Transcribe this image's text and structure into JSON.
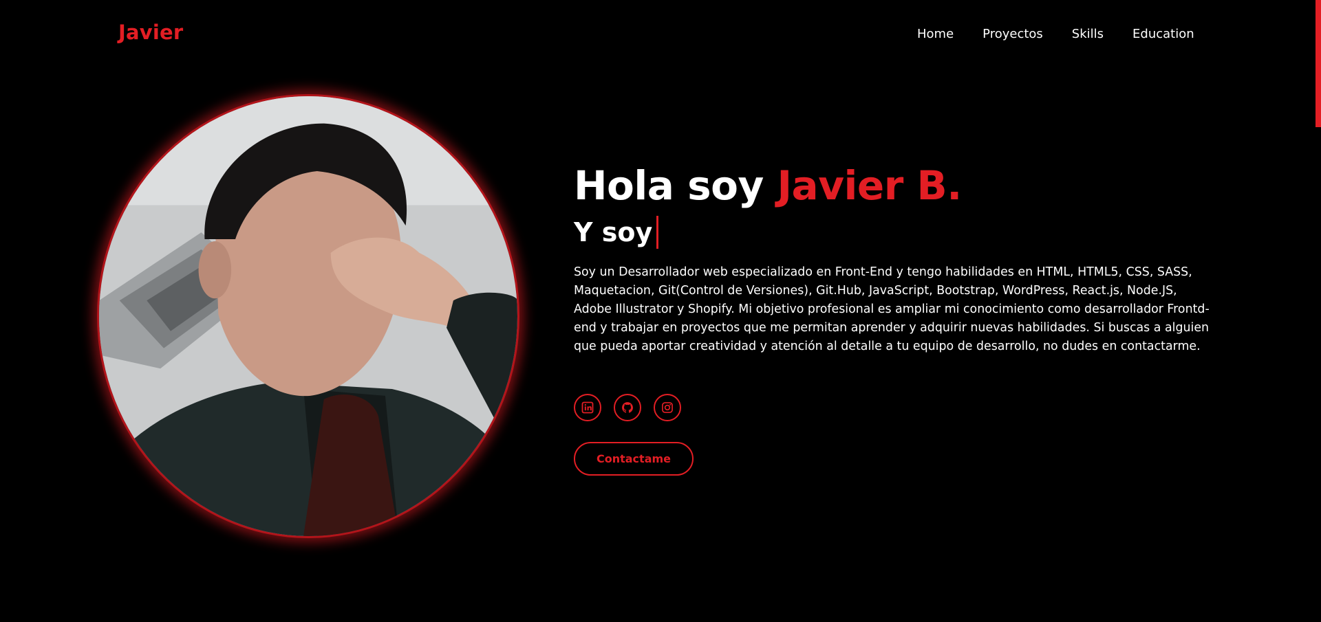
{
  "header": {
    "logo": "Javier",
    "nav": [
      {
        "label": "Home"
      },
      {
        "label": "Proyectos"
      },
      {
        "label": "Skills"
      },
      {
        "label": "Education"
      }
    ]
  },
  "hero": {
    "greeting_prefix": "Hola soy ",
    "greeting_name": "Javier B.",
    "role_prefix": "Y soy",
    "bio": "Soy un Desarrollador web especializado en Front-End y tengo habilidades en HTML, HTML5, CSS, SASS, Maquetacion, Git(Control de Versiones), Git.Hub, JavaScript, Bootstrap, WordPress, React.js, Node.JS, Adobe Illustrator y Shopify. Mi objetivo profesional es ampliar mi conocimiento como desarrollador Frontd-end y trabajar en proyectos que me permitan aprender y adquirir nuevas habilidades. Si buscas a alguien que pueda aportar creatividad y atención al detalle a tu equipo de desarrollo, no dudes en contactarme.",
    "socials": [
      {
        "icon": "linkedin-icon"
      },
      {
        "icon": "github-icon"
      },
      {
        "icon": "instagram-icon"
      }
    ],
    "cta_label": "Contactame"
  },
  "colors": {
    "accent": "#e31e24",
    "background": "#000000",
    "text": "#ffffff"
  }
}
